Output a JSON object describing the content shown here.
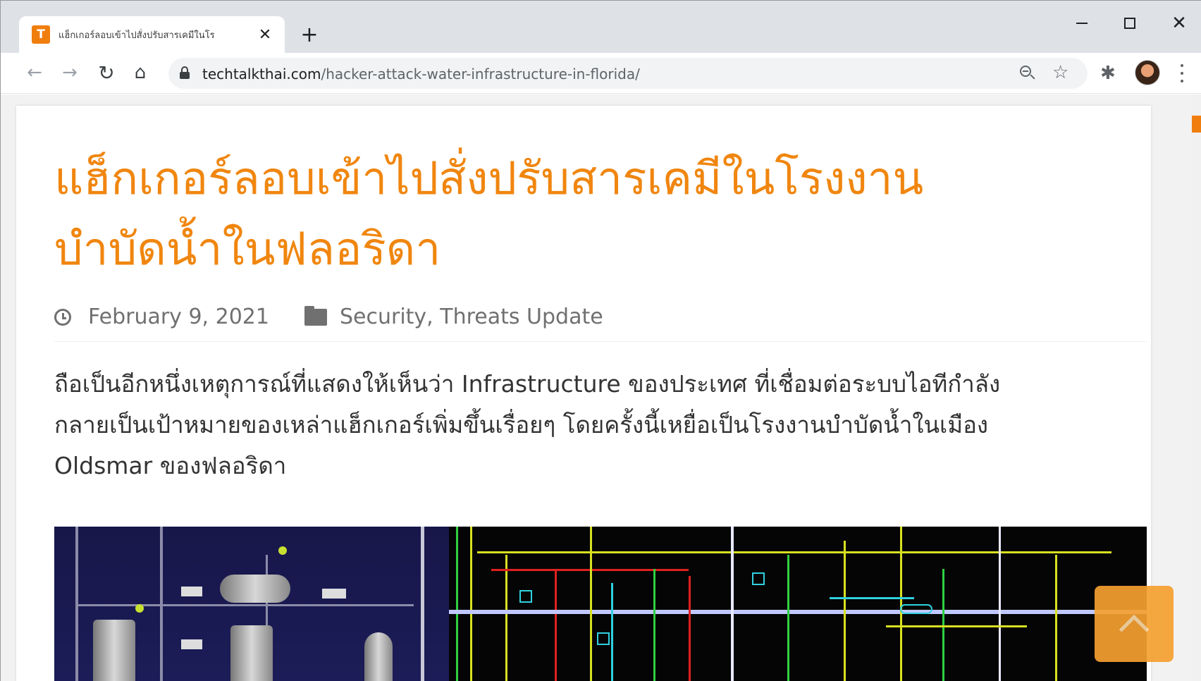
{
  "browser": {
    "tab_title": "แฮ็กเกอร์ลอบเข้าไปสั่งปรับสารเคมีในโร",
    "favicon_letter": "T",
    "close_glyph": "✕",
    "new_tab_glyph": "+",
    "url_host": "techtalkthai.com",
    "url_path": "/hacker-attack-water-infrastructure-in-florida/",
    "icons": [
      "back-arrow-icon",
      "forward-arrow-icon",
      "reload-icon",
      "home-icon",
      "lock-icon",
      "zoom-icon",
      "star-icon",
      "puzzle-extension-icon",
      "avatar",
      "kebab-menu-icon"
    ]
  },
  "article": {
    "title_line1": "แฮ็กเกอร์ลอบเข้าไปสั่งปรับสารเคมีในโรงงาน",
    "title_line2": "บำบัดน้ำในฟลอริดา",
    "date": "February 9, 2021",
    "categories": "Security, Threats Update",
    "excerpt_line1": "ถือเป็นอีกหนึ่งเหตุการณ์ที่แสดงให้เห็นว่า Infrastructure ของประเทศ ที่เชื่อมต่อระบบไอทีกำลัง",
    "excerpt_line2": "กลายเป็นเป้าหมายของเหล่าแฮ็กเกอร์เพิ่มขึ้นเรื่อยๆ โดยครั้งนี้เหยื่อเป็นโรงงานบำบัดน้ำในเมือง",
    "excerpt_line3": "Oldsmar ของฟลอริดา"
  },
  "colors": {
    "accent": "#f0860f",
    "meta_text": "#707070",
    "body_text": "#333333"
  }
}
